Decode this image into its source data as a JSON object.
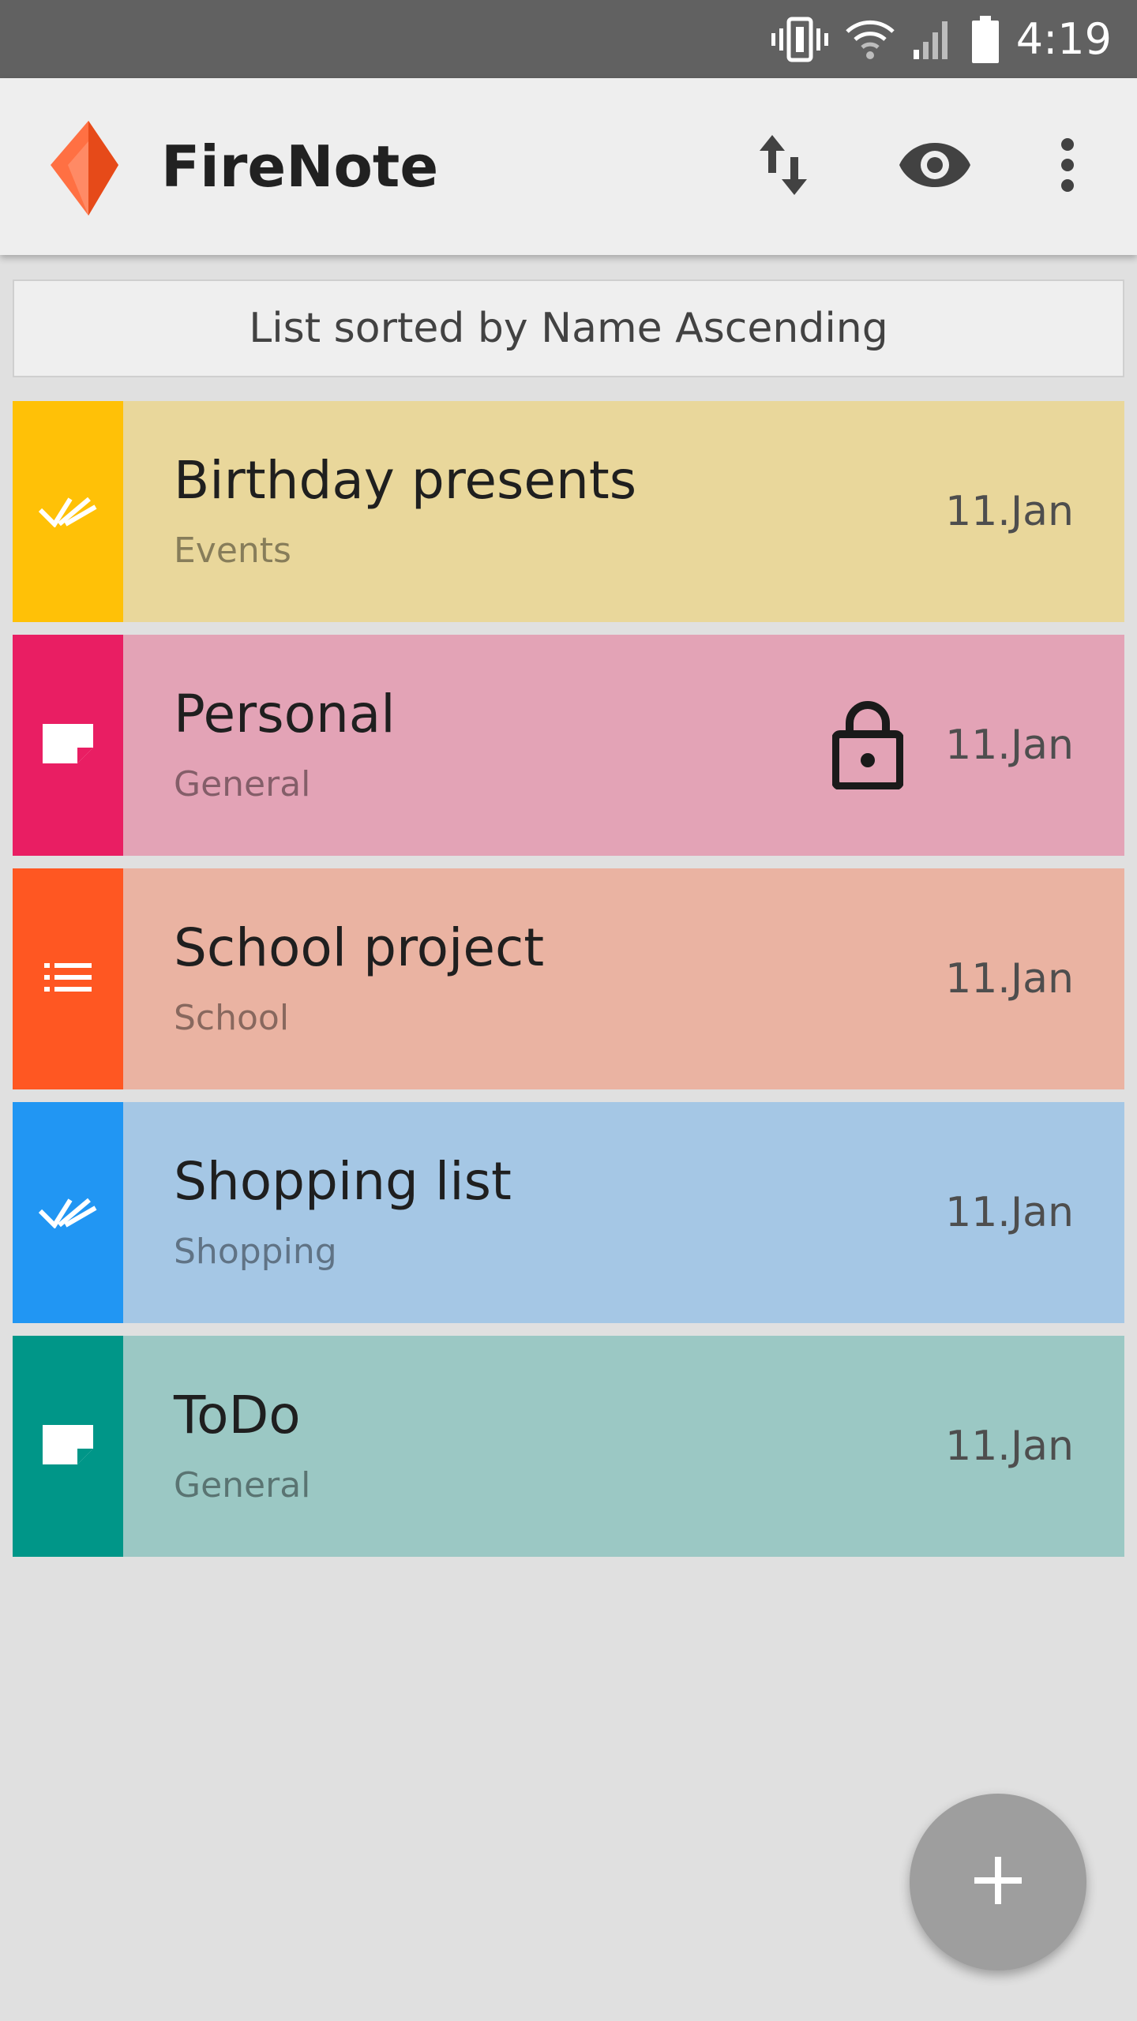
{
  "status_bar": {
    "time": "4:19",
    "icons": [
      "vibrate-icon",
      "wifi-icon",
      "signal-icon",
      "battery-icon"
    ]
  },
  "app_bar": {
    "title": "FireNote",
    "logo_icon": "firenote-flame-logo",
    "actions": [
      "sort-icon",
      "eye-icon",
      "more-vert-icon"
    ]
  },
  "sort_banner": {
    "text": "List sorted by Name Ascending"
  },
  "notes": [
    {
      "title": "Birthday presents",
      "category": "Events",
      "date": "11.Jan",
      "type_icon": "checklist-icon",
      "accent": "#FFC107",
      "background": "#E9D79B",
      "locked": false
    },
    {
      "title": "Personal",
      "category": "General",
      "date": "11.Jan",
      "type_icon": "note-icon",
      "accent": "#E91E63",
      "background": "#E3A3B6",
      "locked": true
    },
    {
      "title": "School project",
      "category": "School",
      "date": "11.Jan",
      "type_icon": "list-icon",
      "accent": "#FF5722",
      "background": "#EAB3A2",
      "locked": false
    },
    {
      "title": "Shopping list",
      "category": "Shopping",
      "date": "11.Jan",
      "type_icon": "checklist-icon",
      "accent": "#2196F3",
      "background": "#A5C7E5",
      "locked": false
    },
    {
      "title": "ToDo",
      "category": "General",
      "date": "11.Jan",
      "type_icon": "note-icon",
      "accent": "#009688",
      "background": "#9BC8C4",
      "locked": false
    }
  ],
  "fab": {
    "icon": "plus-icon",
    "color": "#9E9E9E"
  }
}
